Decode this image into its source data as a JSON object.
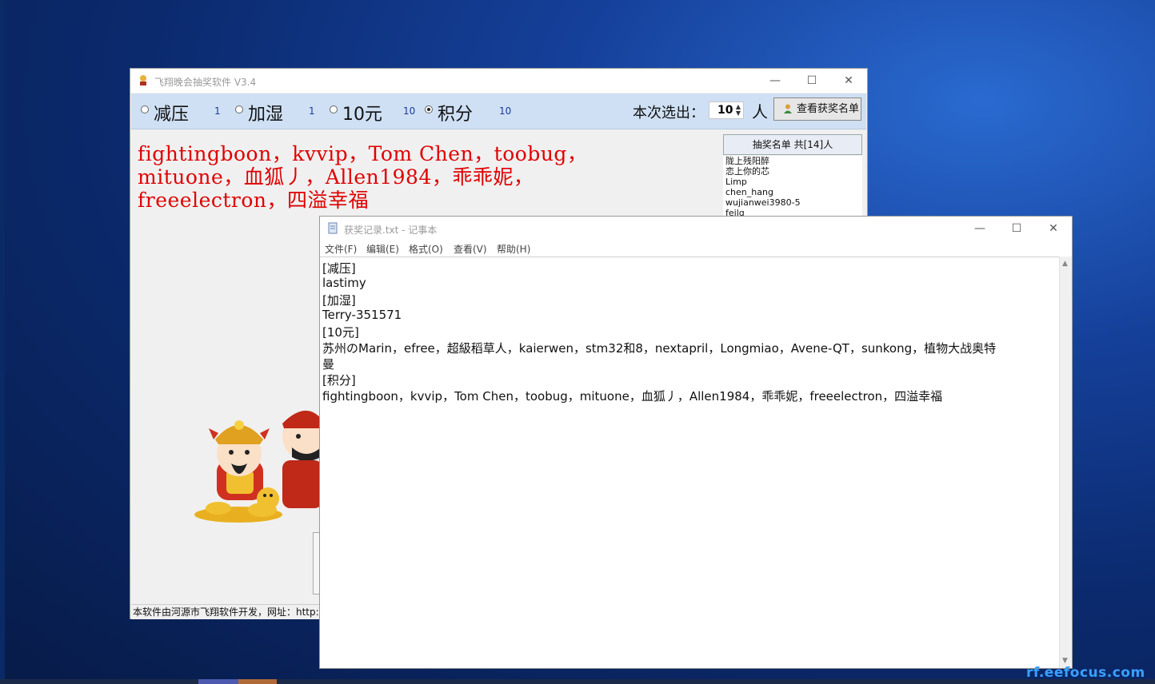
{
  "lottery": {
    "title": "飞翔晚会抽奖软件 V3.4",
    "options": [
      {
        "label": "减压",
        "count": "1",
        "selected": false
      },
      {
        "label": "加湿",
        "count": "1",
        "selected": false
      },
      {
        "label": "10元",
        "count": "10",
        "selected": false
      },
      {
        "label": "积分",
        "count": "10",
        "selected": true
      }
    ],
    "select_label": "本次选出：",
    "select_value": "10",
    "select_unit": "人",
    "view_button": "查看获奖名单",
    "winners_lines": [
      "fightingboon，kvvip，Tom Chen，toobug，",
      "mituone，血狐丿，Allen1984，乖乖妮，",
      "freeelectron，四溢幸福"
    ],
    "list_header": "抽奖名单 共[14]人",
    "list_items": [
      "陇上残阳醉",
      "恋上你的芯",
      "Limp",
      "chen_hang",
      "wujianwei3980-5",
      "feilg"
    ],
    "status_text": "本软件由河源市飞翔软件开发，网址：http:/"
  },
  "notepad": {
    "title": "获奖记录.txt - 记事本",
    "menu": [
      "文件(F)",
      "编辑(E)",
      "格式(O)",
      "查看(V)",
      "帮助(H)"
    ],
    "lines": [
      "[减压]",
      "lastimy",
      "[加湿]",
      "Terry-351571",
      "[10元]",
      "苏州のMarin，efree，超級稻草人，kaierwen，stm32和8，nextapril，Longmiao，Avene-QT，sunkong，植物大战奥特",
      "曼",
      "[积分]",
      "fightingboon，kvvip，Tom Chen，toobug，mituone，血狐丿，Allen1984，乖乖妮，freeelectron，四溢幸福"
    ]
  },
  "watermark": "rf.eefocus.com",
  "colors": {
    "winners_red": "#e00000",
    "toolbar_blue": "#cfe0f4",
    "watermark_blue": "#3aa0ff"
  }
}
